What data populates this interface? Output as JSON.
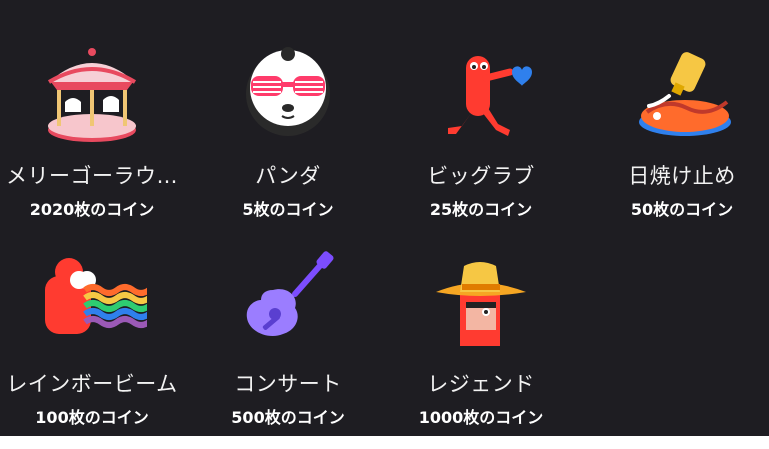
{
  "gifts": [
    {
      "name": "メリーゴーラウ…",
      "price": "2020枚のコイン",
      "icon": "carousel-icon"
    },
    {
      "name": "パンダ",
      "price": "5枚のコイン",
      "icon": "panda-icon"
    },
    {
      "name": "ビッグラブ",
      "price": "25枚のコイン",
      "icon": "big-love-icon"
    },
    {
      "name": "日焼け止め",
      "price": "50枚のコイン",
      "icon": "sunscreen-icon"
    },
    {
      "name": "レインボービーム",
      "price": "100枚のコイン",
      "icon": "rainbow-beam-icon"
    },
    {
      "name": "コンサート",
      "price": "500枚のコイン",
      "icon": "guitar-icon"
    },
    {
      "name": "レジェンド",
      "price": "1000枚のコイン",
      "icon": "legend-cowboy-icon"
    }
  ],
  "colors": {
    "background": "#1e1d22",
    "text": "#ffffff"
  }
}
